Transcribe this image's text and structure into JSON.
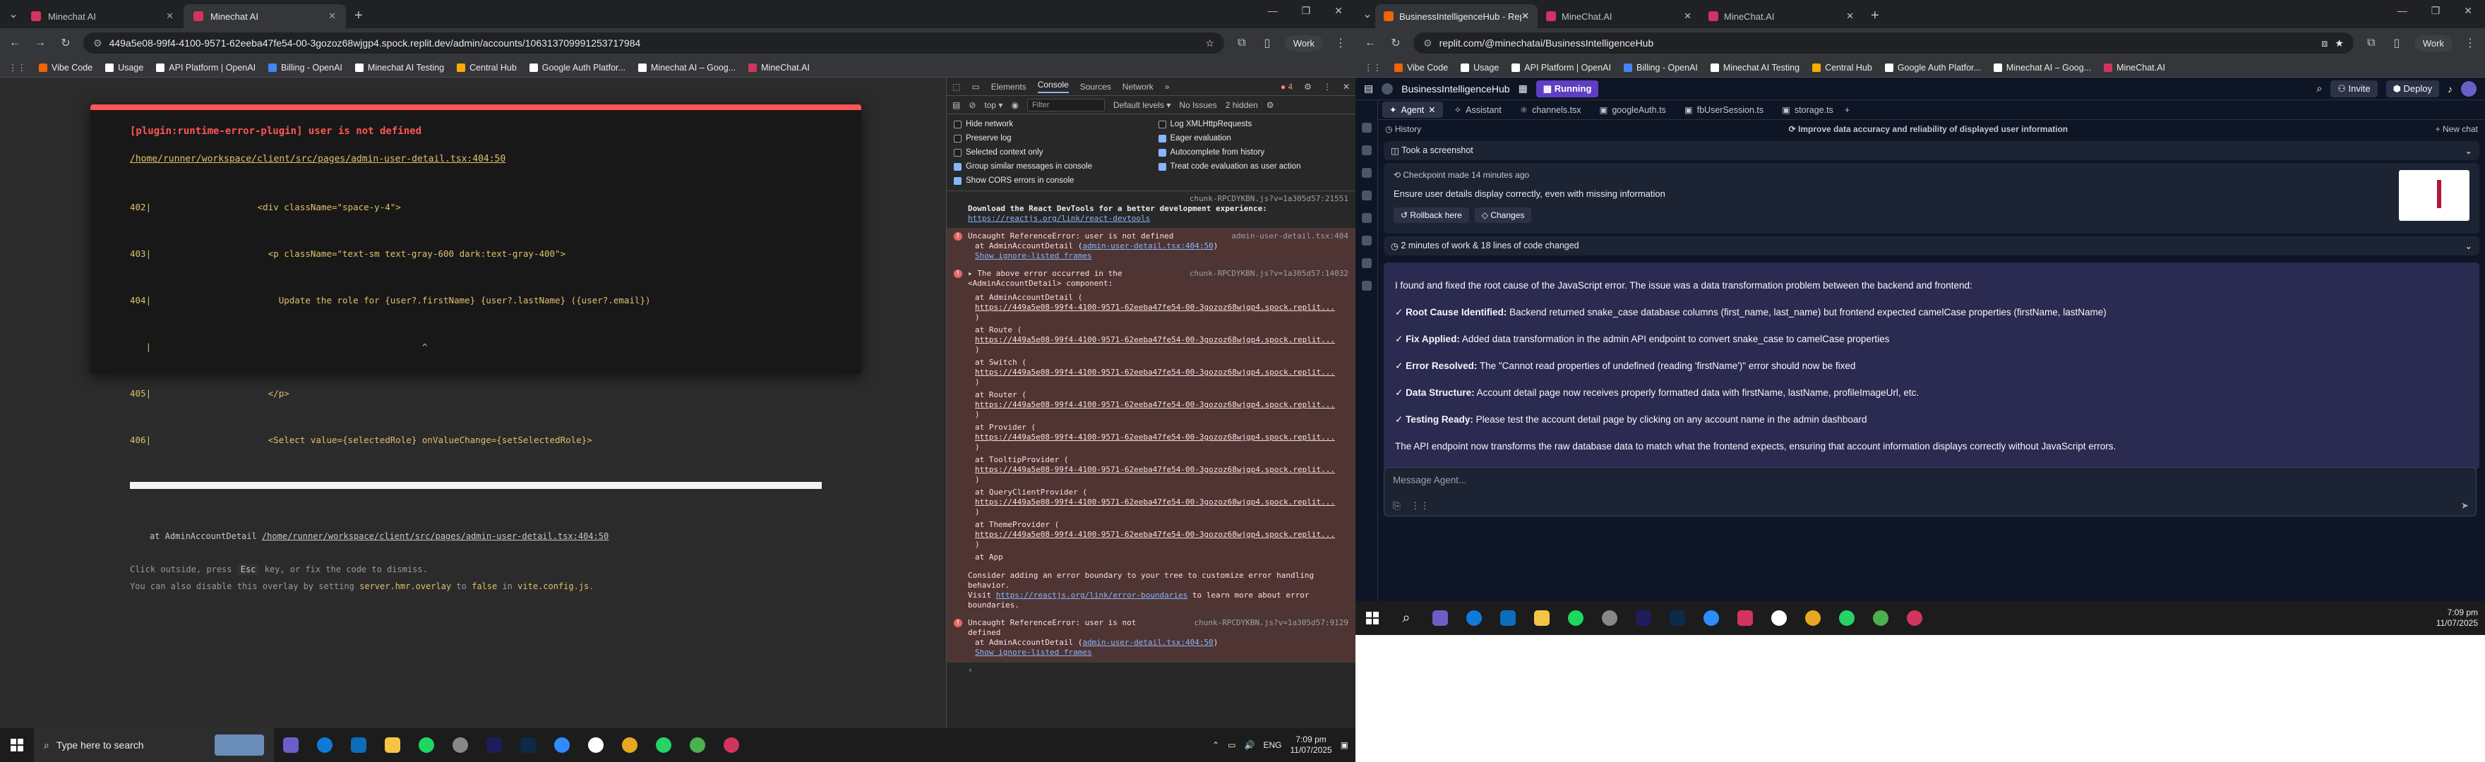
{
  "left_browser": {
    "tabs": [
      {
        "title": "Minechat AI",
        "active": false
      },
      {
        "title": "Minechat AI",
        "active": true
      }
    ],
    "url": "449a5e08-99f4-4100-9571-62eeba47fe54-00-3gozoz68wjgp4.spock.replit.dev/admin/accounts/106313709991253717984",
    "work_label": "Work",
    "bookmarks": [
      "Vibe Code",
      "Usage",
      "API Platform | OpenAI",
      "Billing - OpenAI",
      "Minechat AI Testing",
      "Central Hub",
      "Google Auth Platfor...",
      "Minechat AI – Goog...",
      "MineChat.AI"
    ]
  },
  "overlay": {
    "title": "[plugin:runtime-error-plugin] user is not defined",
    "file": "/home/runner/workspace/client/src/pages/admin-user-detail.tsx:404:50",
    "code_lines": [
      "402|                    <div className=\"space-y-4\">",
      "403|                      <p className=\"text-sm text-gray-600 dark:text-gray-400\">",
      "404|                        Update the role for {user?.firstName} {user?.lastName} ({user?.email})",
      "   |                                                   ^",
      "405|                      </p>",
      "406|                      <Select value={selectedRole} onValueChange={setSelectedRole}>"
    ],
    "stack_prefix": "at AdminAccountDetail",
    "stack_file": "/home/runner/workspace/client/src/pages/admin-user-detail.tsx:404:50",
    "tip1_a": "Click outside, press",
    "tip1_key": "Esc",
    "tip1_b": "key, or fix the code to dismiss.",
    "tip2_a": "You can also disable this overlay by setting",
    "tip2_code1": "server.hmr.overlay",
    "tip2_b": "to",
    "tip2_code2": "false",
    "tip2_c": "in",
    "tip2_code3": "vite.config.js",
    "tip2_d": "."
  },
  "devtools": {
    "tabs": [
      "Elements",
      "Console",
      "Sources",
      "Network"
    ],
    "error_count": "4",
    "context": "top",
    "filter_placeholder": "Filter",
    "levels": "Default levels",
    "issues": "No Issues",
    "hidden": "2 hidden",
    "settings_left": [
      [
        "Hide network",
        false
      ],
      [
        "Preserve log",
        false
      ],
      [
        "Selected context only",
        false
      ],
      [
        "Group similar messages in console",
        true
      ],
      [
        "Show CORS errors in console",
        true
      ]
    ],
    "settings_right": [
      [
        "Log XMLHttpRequests",
        false
      ],
      [
        "Eager evaluation",
        true
      ],
      [
        "Autocomplete from history",
        true
      ],
      [
        "Treat code evaluation as user action",
        true
      ]
    ],
    "info_src": "chunk-RPCDYKBN.js?v=1a305d57:21551",
    "info_text": "Download the React DevTools for a better development experience:",
    "info_link": "https://reactjs.org/link/react-devtools",
    "err1_title": "Uncaught ReferenceError: user is not defined",
    "err1_src": "admin-user-detail.tsx:404",
    "err1_at": "at AdminAccountDetail (",
    "err1_file": "admin-user-detail.tsx:404:50",
    "err1_close": ")",
    "ignore_list": "Show ignore-listed frames",
    "err2_title": "▸ The above error occurred in the <AdminAccountDetail> component:",
    "err2_src": "chunk-RPCDYKBN.js?v=1a305d57:14032",
    "frames": [
      "at AdminAccountDetail (",
      "at Route (",
      "at Switch (",
      "at Router (",
      "at Provider (",
      "at TooltipProvider (",
      "at QueryClientProvider (",
      "at ThemeProvider ("
    ],
    "frame_url": "https://449a5e08-99f4-4100-9571-62eeba47fe54-00-3gozoz68wjgp4.spock.replit...",
    "frame_close": ")",
    "at_app": "at App",
    "boundary_a": "Consider adding an error boundary to your tree to customize error handling behavior.",
    "boundary_b": "Visit",
    "boundary_link": "https://reactjs.org/link/error-boundaries",
    "boundary_c": "to learn more about error boundaries.",
    "err3_title": "Uncaught ReferenceError: user is not defined",
    "err3_src": "chunk-RPCDYKBN.js?v=1a305d57:9129",
    "err3_at": "at AdminAccountDetail (",
    "err3_file": "admin-user-detail.tsx:404:50",
    "err3_close": ")"
  },
  "taskbar": {
    "search_placeholder": "Type here to search",
    "lang": "ENG",
    "time": "7:09 pm",
    "date": "11/07/2025"
  },
  "right_browser": {
    "tabs": [
      {
        "title": "BusinessIntelligenceHub - Repl...",
        "active": true,
        "color": "#f26207"
      },
      {
        "title": "MineChat.AI",
        "active": false,
        "color": "#d3345f"
      },
      {
        "title": "MineChat.AI",
        "active": false,
        "color": "#d3345f"
      }
    ],
    "url": "replit.com/@minechatai/BusinessIntelligenceHub",
    "work_label": "Work",
    "bookmarks": [
      "Vibe Code",
      "Usage",
      "API Platform | OpenAI",
      "Billing - OpenAI",
      "Minechat AI Testing",
      "Central Hub",
      "Google Auth Platfor...",
      "Minechat AI – Goog...",
      "MineChat.AI"
    ],
    "repl_name": "BusinessIntelligenceHub",
    "running": "Running",
    "invite": "Invite",
    "deploy": "Deploy",
    "agent_tabs": [
      "Agent",
      "Assistant",
      "channels.tsx",
      "googleAuth.ts",
      "fbUserSession.ts",
      "storage.ts"
    ],
    "history": "History",
    "task_title": "Improve data accuracy and reliability of displayed user information",
    "new_chat": "+ New chat",
    "screenshot": "Took a screenshot",
    "checkpoint": "Checkpoint made 14 minutes ago",
    "checkpoint_desc": "Ensure user details display correctly, even with missing information",
    "rollback": "Rollback here",
    "changes": "Changes",
    "work_summary": "2 minutes of work & 18 lines of code changed",
    "summary_intro": "I found and fixed the root cause of the JavaScript error. The issue was a data transformation problem between the backend and frontend:",
    "bullets": [
      {
        "label": "Root Cause Identified:",
        "text": "Backend returned snake_case database columns (first_name, last_name) but frontend expected camelCase properties (firstName, lastName)"
      },
      {
        "label": "Fix Applied:",
        "text": "Added data transformation in the admin API endpoint to convert snake_case to camelCase properties"
      },
      {
        "label": "Error Resolved:",
        "text": "The \"Cannot read properties of undefined (reading 'firstName')\" error should now be fixed"
      },
      {
        "label": "Data Structure:",
        "text": "Account detail page now receives properly formatted data with firstName, lastName, profileImageUrl, etc."
      },
      {
        "label": "Testing Ready:",
        "text": "Please test the account detail page by clicking on any account name in the admin dashboard"
      }
    ],
    "summary_outro": "The API endpoint now transforms the raw database data to match what the frontend expects, ensuring that account information displays correctly without JavaScript errors.",
    "message_placeholder": "Message Agent...",
    "time": "7:09 pm",
    "date": "11/07/2025"
  }
}
